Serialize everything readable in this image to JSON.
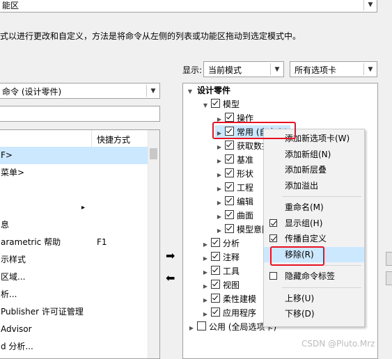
{
  "top_dropdown": {
    "value": "能区"
  },
  "description": "式以进行更改和自定义，方法是将命令从左侧的列表或功能区拖动到选定模式中。",
  "display": {
    "label": "显示:",
    "mode_value": "当前模式",
    "tabs_value": "所有选项卡"
  },
  "left": {
    "command_dropdown": "命令 (设计零件)",
    "search_value": "",
    "columns": {
      "shortcut": "快捷方式"
    },
    "rows": [
      {
        "name": "F>",
        "shortcut": ""
      },
      {
        "name": "菜单>",
        "shortcut": ""
      },
      {
        "name": "",
        "shortcut": ""
      },
      {
        "name": "",
        "shortcut": ""
      },
      {
        "name": "息",
        "shortcut": ""
      },
      {
        "name": "arametric 帮助",
        "shortcut": "F1"
      },
      {
        "name": "示样式",
        "shortcut": ""
      },
      {
        "name": "区域...",
        "shortcut": ""
      },
      {
        "name": "析...",
        "shortcut": ""
      },
      {
        "name": "Publisher 许可证管理",
        "shortcut": ""
      },
      {
        "name": "Advisor",
        "shortcut": ""
      },
      {
        "name": "d 分析...",
        "shortcut": ""
      }
    ]
  },
  "tree": {
    "root": "设计零件",
    "model": "模型",
    "items": [
      {
        "label": "操作",
        "checked": true
      },
      {
        "label": "常用 (自定义)",
        "checked": true
      },
      {
        "label": "获取数据",
        "checked": true
      },
      {
        "label": "基准",
        "checked": true
      },
      {
        "label": "形状",
        "checked": true
      },
      {
        "label": "工程",
        "checked": true
      },
      {
        "label": "编辑",
        "checked": true
      },
      {
        "label": "曲面",
        "checked": true
      },
      {
        "label": "模型意图",
        "checked": true
      }
    ],
    "top_items": [
      {
        "label": "分析",
        "checked": true
      },
      {
        "label": "注释",
        "checked": true
      },
      {
        "label": "工具",
        "checked": true
      },
      {
        "label": "视图",
        "checked": true
      },
      {
        "label": "柔性建模",
        "checked": true
      },
      {
        "label": "应用程序",
        "checked": true
      }
    ],
    "public": "公用 (全局选项卡)"
  },
  "context_menu": {
    "group1": [
      "添加新选项卡(W)",
      "添加新组(N)",
      "添加新层叠",
      "添加溢出"
    ],
    "group2": [
      {
        "label": "重命名(M)",
        "check": null
      },
      {
        "label": "显示组(H)",
        "check": true
      },
      {
        "label": "传播自定义",
        "check": true
      },
      {
        "label": "移除(R)",
        "check": null,
        "highlight": true
      }
    ],
    "group3": [
      {
        "label": "隐藏命令标签",
        "check": false
      }
    ],
    "group4": [
      "上移(U)",
      "下移(D)"
    ]
  },
  "watermark": "CSDN @Pluto.Mrz",
  "colors": {
    "selection": "#cce8ff",
    "highlight_red": "#e81123",
    "menu_hover": "#cce8ff"
  }
}
